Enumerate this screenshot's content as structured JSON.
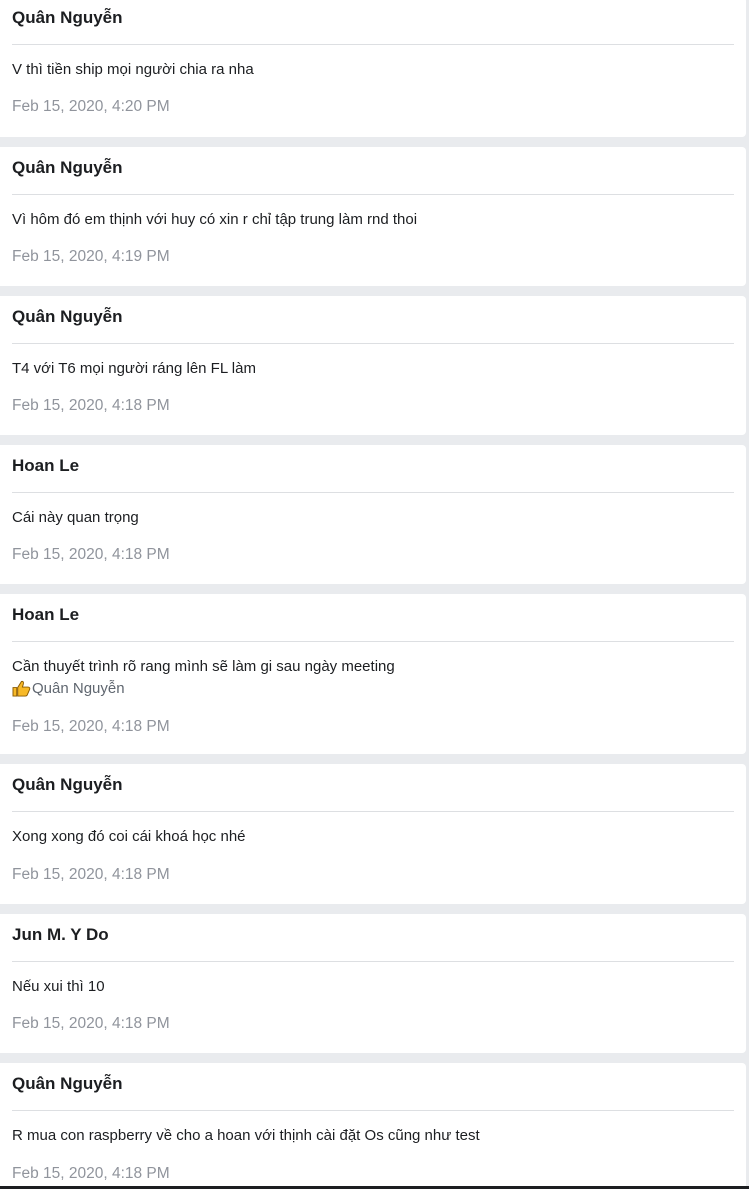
{
  "messages": [
    {
      "sender": "Quân Nguyễn",
      "text": "V thì tiền ship mọi người chia ra nha",
      "time": "Feb 15, 2020, 4:20 PM"
    },
    {
      "sender": "Quân Nguyễn",
      "text": "Vì hôm đó em thịnh với huy có xin r chỉ tập trung làm rnd thoi",
      "time": "Feb 15, 2020, 4:19 PM"
    },
    {
      "sender": "Quân Nguyễn",
      "text": "T4 với T6 mọi người ráng lên FL làm",
      "time": "Feb 15, 2020, 4:18 PM"
    },
    {
      "sender": "Hoan Le",
      "text": "Cái này quan trọng",
      "time": "Feb 15, 2020, 4:18 PM"
    },
    {
      "sender": "Hoan Le",
      "text": "Cần thuyết trình rõ rang mình sẽ làm gi sau ngày meeting",
      "reaction": {
        "icon": "thumbs-up-icon",
        "name": "Quân Nguyễn"
      },
      "time": "Feb 15, 2020, 4:18 PM"
    },
    {
      "sender": "Quân Nguyễn",
      "text": "Xong xong đó coi cái khoá học nhé",
      "time": "Feb 15, 2020, 4:18 PM"
    },
    {
      "sender": "Jun M. Y Do",
      "text": "Nếu xui thì 10",
      "time": "Feb 15, 2020, 4:18 PM"
    },
    {
      "sender": "Quân Nguyễn",
      "text": "R mua con raspberry về cho a hoan với thịnh cài đặt Os cũng như test",
      "time": "Feb 15, 2020, 4:18 PM"
    }
  ],
  "colors": {
    "background": "#e9ebee",
    "card": "#ffffff",
    "sender": "#1c1e21",
    "text": "#1c1e21",
    "timestamp": "#90949c",
    "divider": "#dddfe2",
    "thumb": "#f7b928"
  }
}
